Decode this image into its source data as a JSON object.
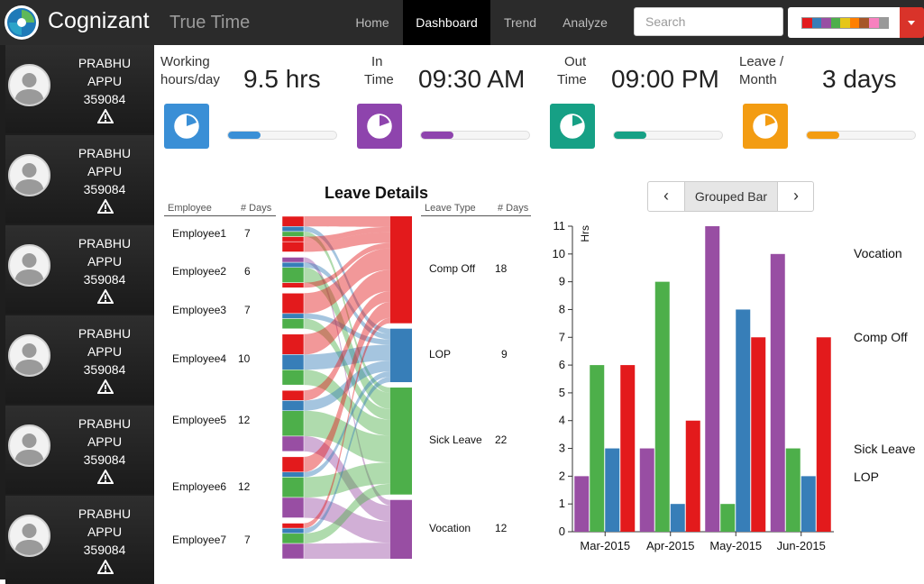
{
  "app": {
    "brand": "Cognizant",
    "title": "True Time",
    "nav": [
      "Home",
      "Dashboard",
      "Trend",
      "Analyze"
    ],
    "active_nav": "Dashboard",
    "search_placeholder": "Search",
    "theme_swatches": [
      "#e31a1c",
      "#377eb8",
      "#984ea3",
      "#4daf4a",
      "#e6c619",
      "#ff7f00",
      "#a65628",
      "#f781bf",
      "#999999"
    ]
  },
  "sidebar": {
    "cards": [
      {
        "first": "PRABHU",
        "last": "APPU",
        "id": "359084"
      },
      {
        "first": "PRABHU",
        "last": "APPU",
        "id": "359084"
      },
      {
        "first": "PRABHU",
        "last": "APPU",
        "id": "359084"
      },
      {
        "first": "PRABHU",
        "last": "APPU",
        "id": "359084"
      },
      {
        "first": "PRABHU",
        "last": "APPU",
        "id": "359084"
      },
      {
        "first": "PRABHU",
        "last": "APPU",
        "id": "359084"
      }
    ]
  },
  "kpis": [
    {
      "label_line1": "Working",
      "label_line2": "hours/day",
      "value": "9.5 hrs",
      "color": "#3a8fd6",
      "fill": 0.3
    },
    {
      "label_line1": "In",
      "label_line2": "Time",
      "value": "09:30 AM",
      "color": "#8e44ad",
      "fill": 0.3
    },
    {
      "label_line1": "Out",
      "label_line2": "Time",
      "value": "09:00 PM",
      "color": "#16a085",
      "fill": 0.3
    },
    {
      "label_line1": "Leave /",
      "label_line2": "Month",
      "value": "3 days",
      "color": "#f39c12",
      "fill": 0.3
    }
  ],
  "leave_details": {
    "title": "Leave Details",
    "employee_header": "Employee",
    "days_header": "# Days",
    "leave_type_header": "Leave Type",
    "employees": [
      {
        "name": "Employee1",
        "days": "7"
      },
      {
        "name": "Employee2",
        "days": "6"
      },
      {
        "name": "Employee3",
        "days": "7"
      },
      {
        "name": "Employee4",
        "days": "10"
      },
      {
        "name": "Employee5",
        "days": "12"
      },
      {
        "name": "Employee6",
        "days": "12"
      },
      {
        "name": "Employee7",
        "days": "7"
      }
    ],
    "leave_types": [
      {
        "name": "Comp Off",
        "days": "18",
        "color": "#e31a1c"
      },
      {
        "name": "LOP",
        "days": "9",
        "color": "#377eb8"
      },
      {
        "name": "Sick Leave",
        "days": "22",
        "color": "#4daf4a"
      },
      {
        "name": "Vocation",
        "days": "12",
        "color": "#984ea3"
      }
    ],
    "flows": [
      {
        "emp": 0,
        "type": "Comp Off",
        "days": 2
      },
      {
        "emp": 0,
        "type": "LOP",
        "days": 1
      },
      {
        "emp": 0,
        "type": "Sick Leave",
        "days": 1
      },
      {
        "emp": 0,
        "type": "Comp Off",
        "days": 1
      },
      {
        "emp": 0,
        "type": "Comp Off",
        "days": 2
      },
      {
        "emp": 1,
        "type": "Vocation",
        "days": 1
      },
      {
        "emp": 1,
        "type": "LOP",
        "days": 1
      },
      {
        "emp": 1,
        "type": "Sick Leave",
        "days": 3
      },
      {
        "emp": 1,
        "type": "Comp Off",
        "days": 1
      },
      {
        "emp": 2,
        "type": "Comp Off",
        "days": 4
      },
      {
        "emp": 2,
        "type": "LOP",
        "days": 1
      },
      {
        "emp": 2,
        "type": "Sick Leave",
        "days": 2
      },
      {
        "emp": 3,
        "type": "Comp Off",
        "days": 4
      },
      {
        "emp": 3,
        "type": "LOP",
        "days": 3
      },
      {
        "emp": 3,
        "type": "Sick Leave",
        "days": 3
      },
      {
        "emp": 4,
        "type": "Comp Off",
        "days": 2
      },
      {
        "emp": 4,
        "type": "LOP",
        "days": 2
      },
      {
        "emp": 4,
        "type": "Sick Leave",
        "days": 5
      },
      {
        "emp": 4,
        "type": "Vocation",
        "days": 3
      },
      {
        "emp": 5,
        "type": "Comp Off",
        "days": 3
      },
      {
        "emp": 5,
        "type": "LOP",
        "days": 1
      },
      {
        "emp": 5,
        "type": "Sick Leave",
        "days": 4
      },
      {
        "emp": 5,
        "type": "Vocation",
        "days": 4
      },
      {
        "emp": 6,
        "type": "Comp Off",
        "days": 1
      },
      {
        "emp": 6,
        "type": "LOP",
        "days": 1
      },
      {
        "emp": 6,
        "type": "Sick Leave",
        "days": 2
      },
      {
        "emp": 6,
        "type": "Vocation",
        "days": 3
      }
    ]
  },
  "bar_panel": {
    "mode": "Grouped Bar",
    "prev_glyph": "‹",
    "next_glyph": "›"
  },
  "chart_data": {
    "type": "bar",
    "categories": [
      "Mar-2015",
      "Apr-2015",
      "May-2015",
      "Jun-2015"
    ],
    "series": [
      {
        "name": "Vocation",
        "color": "#984ea3",
        "values": [
          2,
          3,
          11,
          10
        ]
      },
      {
        "name": "Sick Leave",
        "color": "#4daf4a",
        "values": [
          6,
          9,
          1,
          3
        ]
      },
      {
        "name": "LOP",
        "color": "#377eb8",
        "values": [
          3,
          1,
          8,
          2
        ]
      },
      {
        "name": "Comp Off",
        "color": "#e31a1c",
        "values": [
          6,
          4,
          7,
          7
        ]
      }
    ],
    "ylabel": "Hrs",
    "ylim": [
      0,
      11
    ],
    "yticks": [
      0,
      1,
      2,
      3,
      4,
      5,
      6,
      7,
      8,
      9,
      10,
      11
    ],
    "legend_order": [
      "Vocation",
      "Comp Off",
      "Sick Leave",
      "LOP"
    ],
    "grid": false
  }
}
